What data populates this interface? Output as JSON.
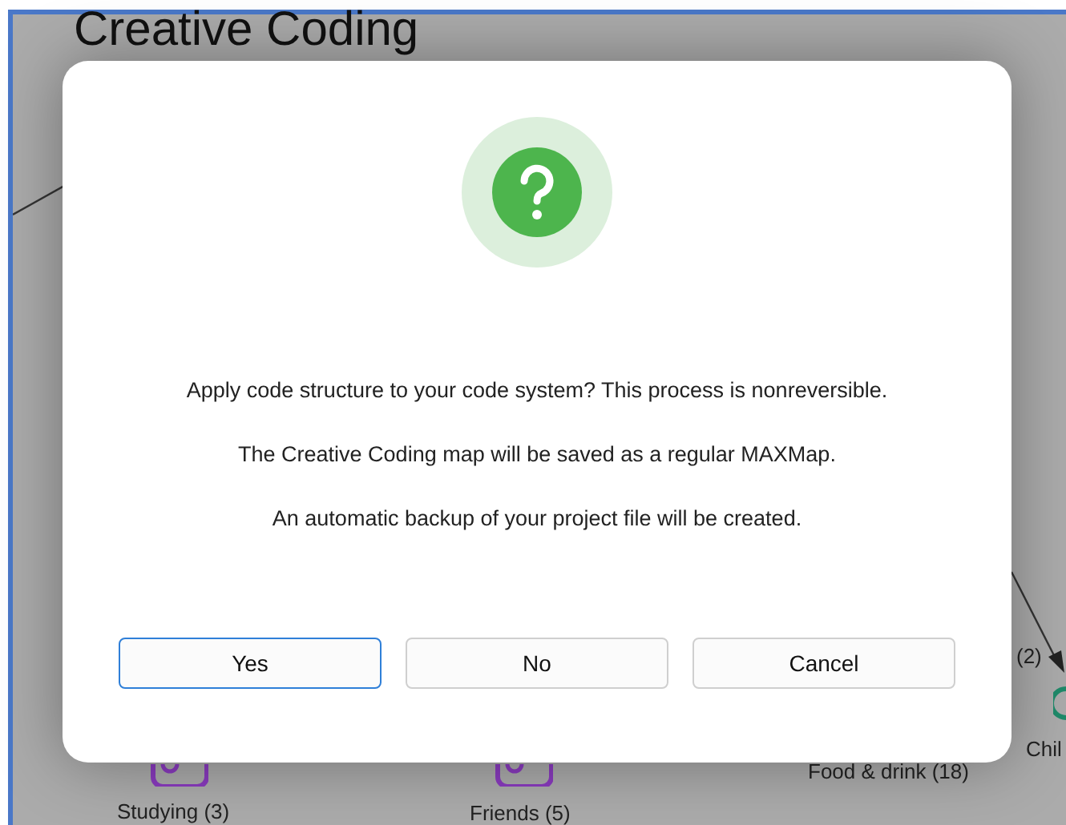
{
  "map": {
    "title": "Creative Coding",
    "nodes": [
      {
        "label": "Studying (3)",
        "kind": "tag"
      },
      {
        "label": "Friends (5)",
        "kind": "tag"
      },
      {
        "label": "Food & drink (18)",
        "kind": "plain"
      },
      {
        "label": "Chil",
        "kind": "circle"
      }
    ],
    "edge_label": "(2)"
  },
  "dialog": {
    "messages": [
      "Apply code structure to your code system? This process is nonreversible.",
      "The Creative Coding map will be saved as a regular MAXMap.",
      "An automatic backup of your project file will be created."
    ],
    "buttons": [
      {
        "label": "Yes",
        "selected": true
      },
      {
        "label": "No",
        "selected": false
      },
      {
        "label": "Cancel",
        "selected": false
      }
    ]
  }
}
